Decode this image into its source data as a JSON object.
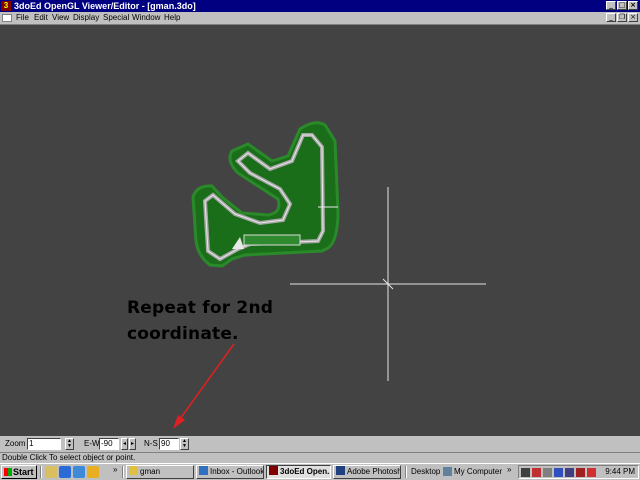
{
  "window": {
    "app_icon": "3",
    "title": "3doEd OpenGL Viewer/Editor - [gman.3do]",
    "controls": [
      "minimize-icon",
      "maximize-icon",
      "close-icon"
    ]
  },
  "menu": [
    "File",
    "Edit",
    "View",
    "Display",
    "Special",
    "Window",
    "Help"
  ],
  "viewport": {
    "background": "#434343",
    "annotation": "Repeat for 2nd\ncoordinate.",
    "track_color": "#1a6e1a",
    "arrow_color": "#e02020"
  },
  "toolbar": {
    "zoom_label": "Zoom",
    "zoom_value": "1",
    "ew_label": "E-W",
    "ew_value": "-90",
    "ns_label": "N-S",
    "ns_value": "90"
  },
  "status": "Double Click To select object or point.",
  "taskbar": {
    "start": "Start",
    "tasks": [
      {
        "label": "gman",
        "icon": "folder-icon",
        "active": false
      },
      {
        "label": "Inbox - Outlook...",
        "icon": "outlook-icon",
        "active": false
      },
      {
        "label": "3doEd Open...",
        "icon": "3doed-icon",
        "active": true
      },
      {
        "label": "Adobe Photosh...",
        "icon": "photoshop-icon",
        "active": false
      }
    ],
    "desktop": "Desktop",
    "my_computer": "My Computer",
    "clock": "9:44 PM"
  }
}
